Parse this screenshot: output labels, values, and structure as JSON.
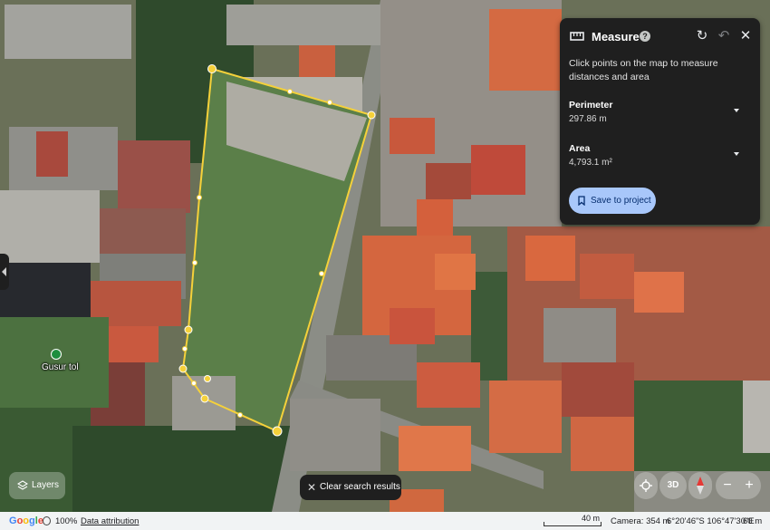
{
  "panel": {
    "title": "Measure",
    "help_icon": "help-icon",
    "description": "Click points on the map to measure distances and area",
    "perimeter_label": "Perimeter",
    "perimeter_value": "297.86 m",
    "area_label": "Area",
    "area_value": "4,793.1 m²",
    "save_label": "Save to project"
  },
  "map": {
    "place_label": "Gusur tol",
    "measure_color": "#f5d13a"
  },
  "controls": {
    "layers_label": "Layers",
    "clear_label": "Clear search results",
    "three_d_label": "3D",
    "zoom_out": "−",
    "zoom_in": "+"
  },
  "footer": {
    "brand": "Google",
    "zoom_percent": "100%",
    "attribution": "Data attribution",
    "scale": "40 m",
    "camera": "Camera: 354 m",
    "coordinates": "6°20'46\"S 106°47'30\"E",
    "altitude": "60 m"
  }
}
